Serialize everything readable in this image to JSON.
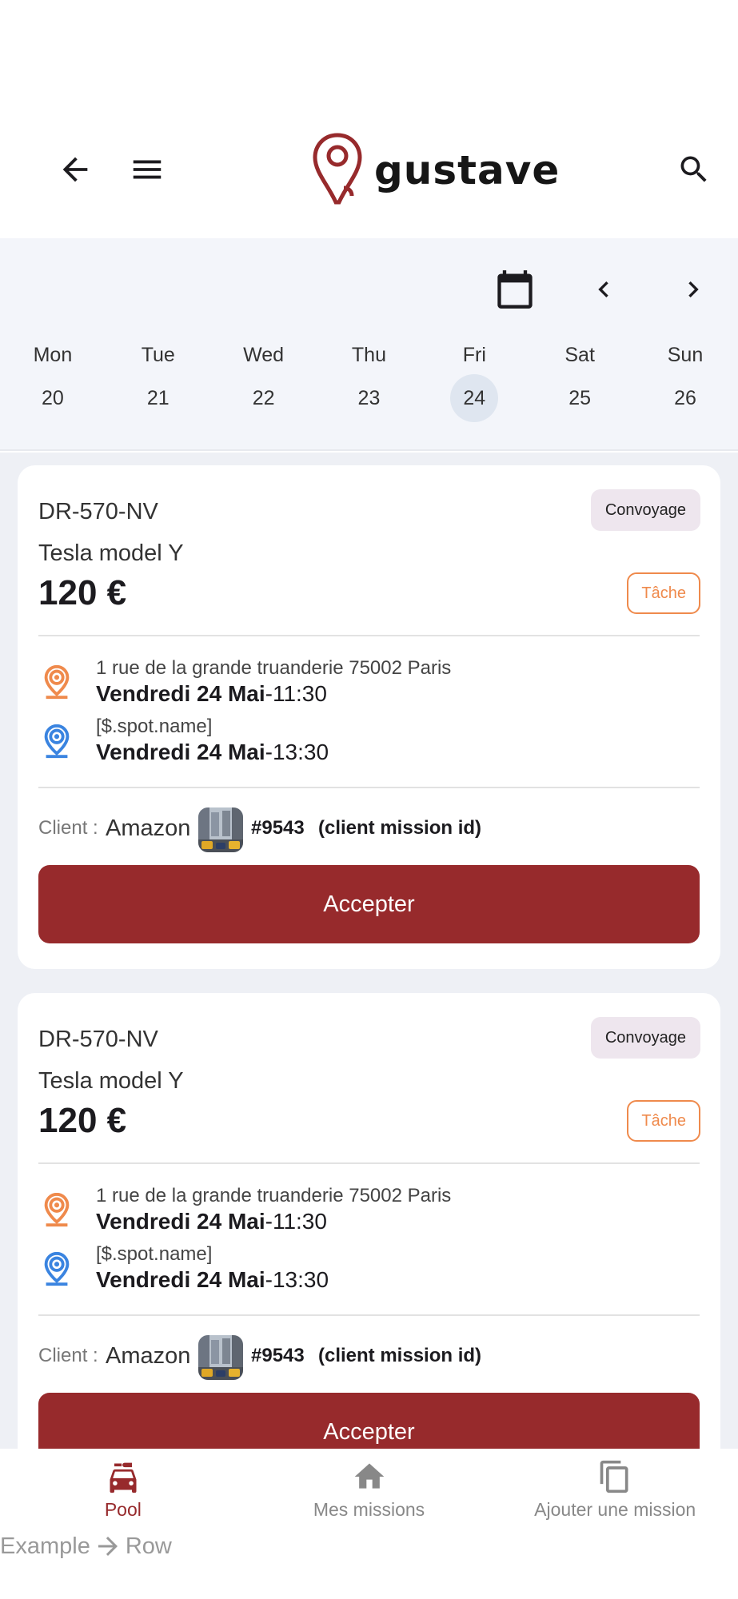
{
  "header": {
    "logo_text": "gustave",
    "brand_color": "#972a2c",
    "icons": [
      "arrow-left-icon",
      "hamburger-menu-icon",
      "search-icon"
    ]
  },
  "calendar": {
    "days": [
      {
        "name": "Mon",
        "num": "20"
      },
      {
        "name": "Tue",
        "num": "21"
      },
      {
        "name": "Wed",
        "num": "22"
      },
      {
        "name": "Thu",
        "num": "23"
      },
      {
        "name": "Fri",
        "num": "24",
        "selected": true
      },
      {
        "name": "Sat",
        "num": "25"
      },
      {
        "name": "Sun",
        "num": "26"
      }
    ]
  },
  "missions": [
    {
      "plate": "DR-570-NV",
      "model": "Tesla model Y",
      "price": "120 €",
      "type_badge": "Convoyage",
      "task_badge": "Tâche",
      "pickup_address": "1 rue de la grande truanderie 75002 Paris",
      "pickup_date": "Vendredi 24 Mai",
      "pickup_time": "-11:30",
      "dropoff_address": "[$.spot.name]",
      "dropoff_date": "Vendredi 24 Mai",
      "dropoff_time": "-13:30",
      "client_label": "Client :",
      "client_name": "Amazon",
      "mission_id": "#9543",
      "mission_note": "(client mission id)",
      "accept_label": "Accepter"
    },
    {
      "plate": "DR-570-NV",
      "model": "Tesla model Y",
      "price": "120 €",
      "type_badge": "Convoyage",
      "task_badge": "Tâche",
      "pickup_address": "1 rue de la grande truanderie 75002 Paris",
      "pickup_date": "Vendredi 24 Mai",
      "pickup_time": "-11:30",
      "dropoff_address": "[$.spot.name]",
      "dropoff_date": "Vendredi 24 Mai",
      "dropoff_time": "-13:30",
      "client_label": "Client :",
      "client_name": "Amazon",
      "mission_id": "#9543",
      "mission_note": "(client mission id)",
      "accept_label": "Accepter"
    }
  ],
  "bottom_nav": [
    {
      "label": "Pool",
      "icon": "car-icon",
      "active": true
    },
    {
      "label": "Mes missions",
      "icon": "home-icon"
    },
    {
      "label": "Ajouter une mission",
      "icon": "copy-icon"
    }
  ],
  "footer_example": {
    "left": "Example",
    "right": "Row"
  }
}
